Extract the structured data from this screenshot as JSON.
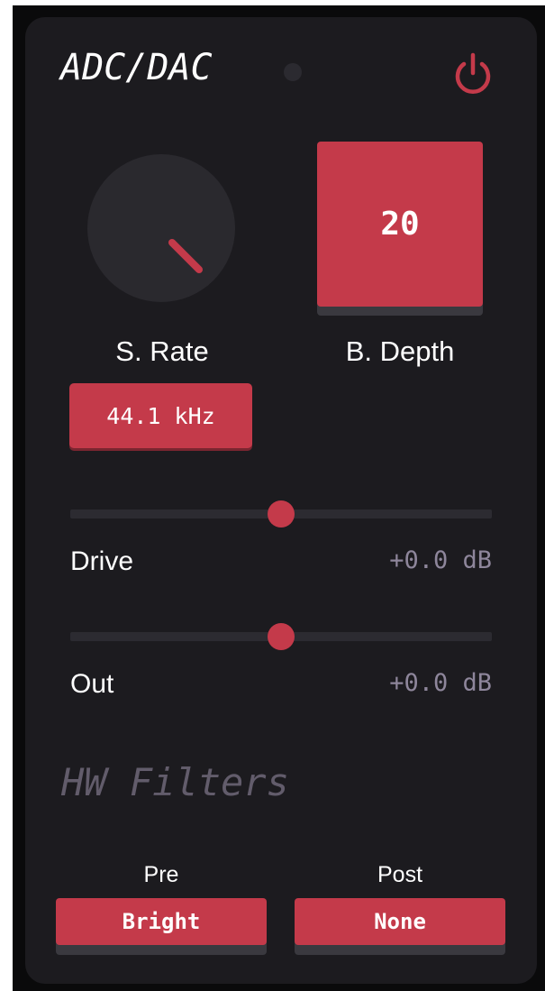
{
  "plugin": {
    "title": "ADC/DAC",
    "bypass_led_color": "#2b2a30",
    "power_icon": "power-icon",
    "accent_color": "#c43a4a"
  },
  "sample_rate": {
    "label": "S. Rate",
    "value": "44.1 kHz",
    "knob_position": 0.85
  },
  "bit_depth": {
    "label": "B. Depth",
    "value": "20"
  },
  "sliders": [
    {
      "name": "Drive",
      "value": "+0.0 dB",
      "position": 0.5
    },
    {
      "name": "Out",
      "value": "+0.0 dB",
      "position": 0.5
    }
  ],
  "filters": {
    "title": "HW Filters",
    "pre": {
      "label": "Pre",
      "value": "Bright"
    },
    "post": {
      "label": "Post",
      "value": "None"
    }
  }
}
